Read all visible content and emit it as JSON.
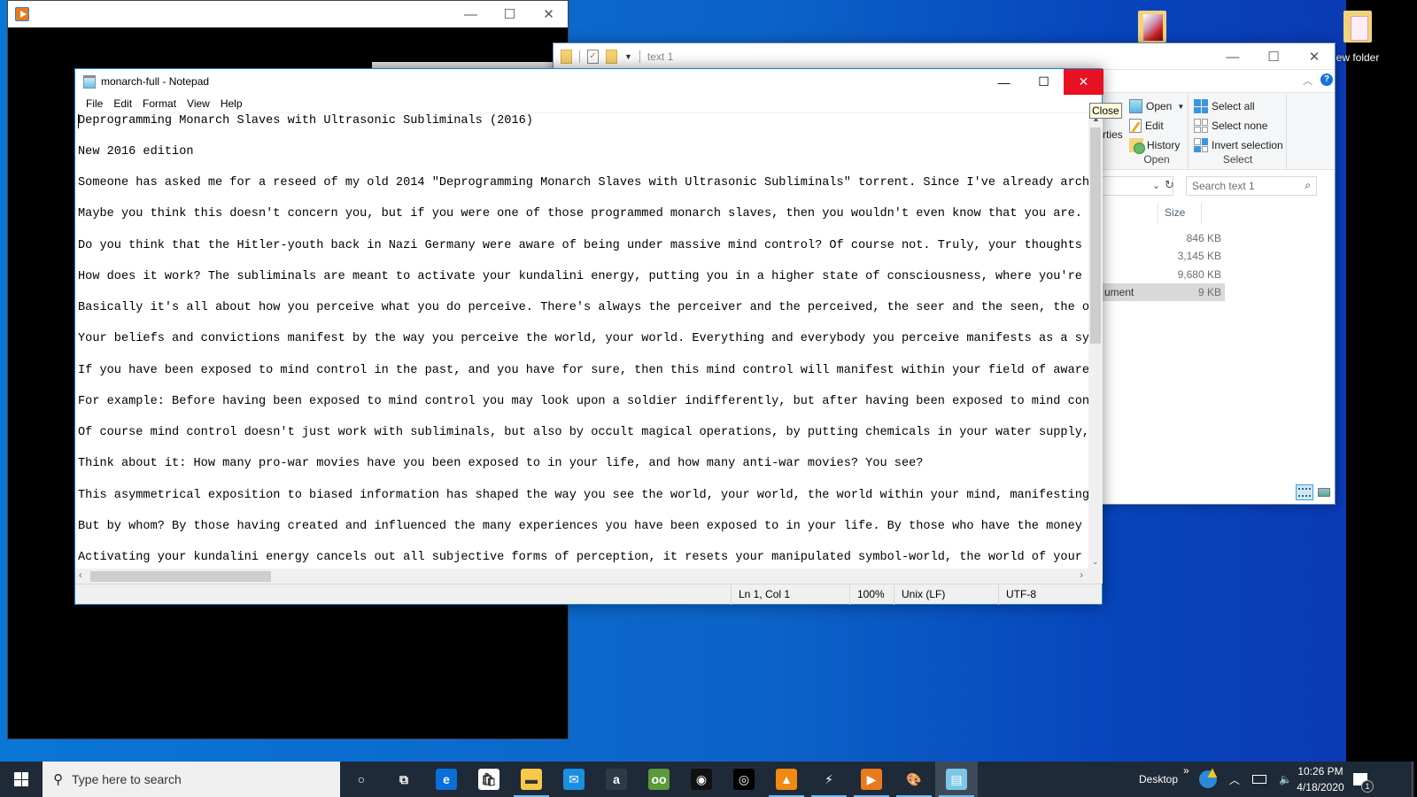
{
  "desktop": {
    "icons": [
      {
        "label": "",
        "kind": "photo-folder"
      },
      {
        "label": "ew folder",
        "kind": "pink-folder"
      }
    ]
  },
  "media_player_window": {
    "icon": "media-player-icon",
    "controls": {
      "minimize": "—",
      "maximize": "☐",
      "close": "✕"
    }
  },
  "explorer": {
    "title": "text 1",
    "controls": {
      "minimize": "—",
      "maximize": "☐",
      "close": "✕"
    },
    "ribbon": {
      "properties_fragment": "rties",
      "open_group": {
        "title": "Open",
        "buttons": [
          {
            "label": "Open",
            "icon": "notepad-icon",
            "has_dropdown": true
          },
          {
            "label": "Edit",
            "icon": "edit-icon"
          },
          {
            "label": "History",
            "icon": "history-icon"
          }
        ]
      },
      "select_group": {
        "title": "Select",
        "buttons": [
          {
            "label": "Select all",
            "icon": "select-all-icon"
          },
          {
            "label": "Select none",
            "icon": "select-none-icon"
          },
          {
            "label": "Invert selection",
            "icon": "invert-selection-icon"
          }
        ]
      }
    },
    "search": {
      "placeholder": "Search text 1"
    },
    "columns": {
      "size": "Size"
    },
    "files": [
      {
        "name_fragment": "",
        "size": "846 KB",
        "selected": false
      },
      {
        "name_fragment": "",
        "size": "3,145 KB",
        "selected": false
      },
      {
        "name_fragment": "",
        "size": "9,680 KB",
        "selected": false
      },
      {
        "name_fragment": "ument",
        "size": "9 KB",
        "selected": true
      }
    ]
  },
  "notepad": {
    "title": "monarch-full - Notepad",
    "controls": {
      "minimize": "—",
      "maximize": "☐",
      "close": "✕"
    },
    "tooltip": "Close",
    "menu": [
      "File",
      "Edit",
      "Format",
      "View",
      "Help"
    ],
    "lines": [
      "Deprogramming Monarch Slaves with Ultrasonic Subliminals (2016)",
      "New 2016 edition",
      "Someone has asked me for a reseed of my old 2014 \"Deprogramming Monarch Slaves with Ultrasonic Subliminals\" torrent. Since I've already archived",
      "Maybe you think this doesn't concern you, but if you were one of those programmed monarch slaves, then you wouldn't even know that you are. One e",
      "Do you think that the Hitler-youth back in Nazi Germany were aware of being under massive mind control? Of course not. Truly, your thoughts are n",
      "How does it work? The subliminals are meant to activate your kundalini energy, putting you in a higher state of consciousness, where you're more",
      "Basically it's all about how you perceive what you do perceive. There's always the perceiver and the perceived, the seer and the seen, the observ",
      "Your beliefs and convictions manifest by the way you perceive the world, your world. Everything and everybody you perceive manifests as a symbol",
      "If you have been exposed to mind control in the past, and you have for sure, then this mind control will manifest within your field of awareness",
      "For example: Before having been exposed to mind control you may look upon a soldier indifferently, but after having been exposed to mind control",
      "Of course mind control doesn't just work with subliminals, but also by occult magical operations, by putting chemicals in your water supply, and",
      "Think about it: How many pro-war movies have you been exposed to in your life, and how many anti-war movies? You see?",
      "This asymmetrical exposition to biased information has shaped the way you see the world, your world, the world within your mind, manifesting the",
      "But by whom? By those having created and influenced the many experiences you have been exposed to in your life. By those who have the money to fi",
      "Activating your kundalini energy cancels out all subjective forms of perception, it resets your manipulated symbol-world, the world of your subje"
    ],
    "status": {
      "position": "Ln 1, Col 1",
      "zoom": "100%",
      "line_ending": "Unix (LF)",
      "encoding": "UTF-8"
    },
    "scroll": {
      "vertical_fraction": 0.0,
      "horizontal_fraction": 0.0
    }
  },
  "taskbar": {
    "search_placeholder": "Type here to search",
    "apps": [
      {
        "name": "cortana",
        "glyph": "○",
        "color": "#1e2a38"
      },
      {
        "name": "task-view",
        "glyph": "⧉",
        "color": "#1e2a38"
      },
      {
        "name": "edge",
        "glyph": "e",
        "color": "#0a6fd8"
      },
      {
        "name": "store",
        "glyph": "🛍",
        "color": "#ffffff"
      },
      {
        "name": "file-explorer",
        "glyph": "▬",
        "color": "#f6c94a",
        "running": true
      },
      {
        "name": "mail",
        "glyph": "✉",
        "color": "#1a8fe0"
      },
      {
        "name": "amazon",
        "glyph": "a",
        "color": "#2d3a48"
      },
      {
        "name": "tripadvisor",
        "glyph": "oo",
        "color": "#5a9a3a"
      },
      {
        "name": "camera-app",
        "glyph": "◉",
        "color": "#111111"
      },
      {
        "name": "webcam-app",
        "glyph": "◎",
        "color": "#000000"
      },
      {
        "name": "vlc",
        "glyph": "▲",
        "color": "#f08a10",
        "running": true
      },
      {
        "name": "winamp",
        "glyph": "⚡",
        "color": "#1e2a38",
        "running": true
      },
      {
        "name": "media-player",
        "glyph": "▶",
        "color": "#e87a1c",
        "running": true
      },
      {
        "name": "paint",
        "glyph": "🎨",
        "color": "#1e2a38",
        "running": true
      },
      {
        "name": "notepad",
        "glyph": "▤",
        "color": "#7cc6e6",
        "running": true,
        "active": true
      }
    ],
    "tray": {
      "desktop_label": "Desktop",
      "overflow": "»",
      "time": "10:26 PM",
      "date": "4/18/2020",
      "notifications": "1"
    }
  }
}
